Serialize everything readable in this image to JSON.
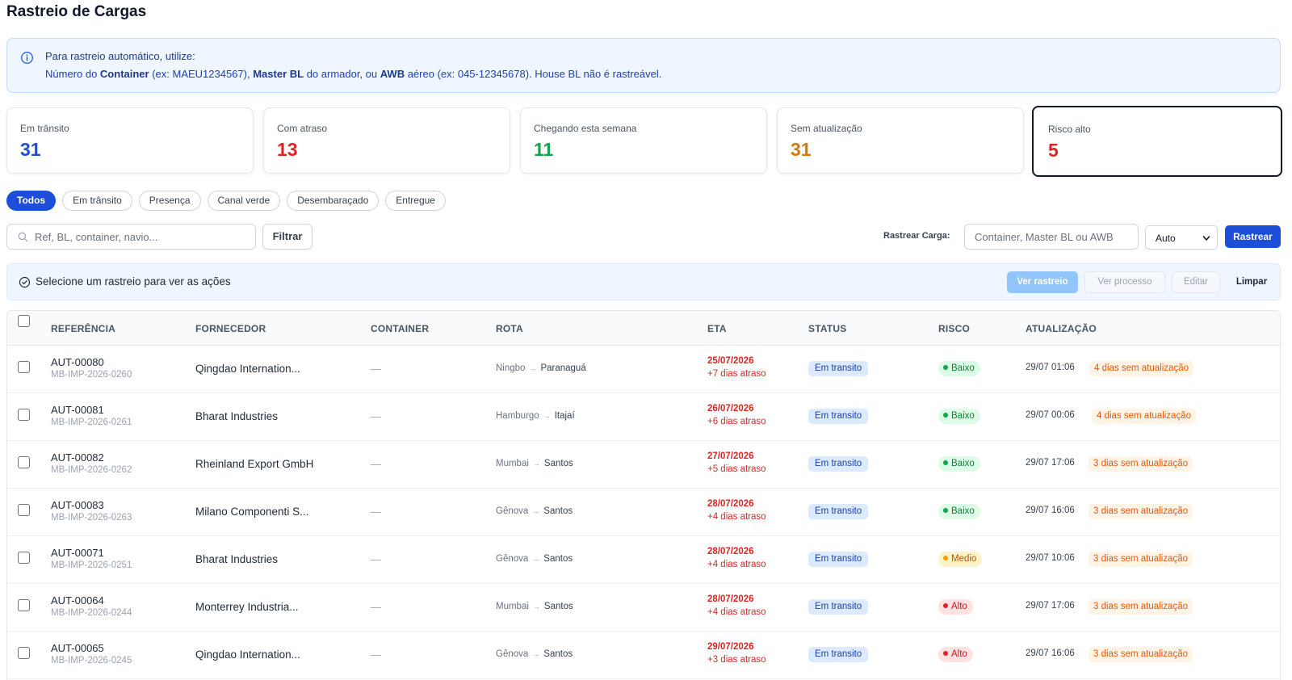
{
  "page": {
    "title": "Rastreio de Cargas"
  },
  "info": {
    "line1": "Para rastreio automático, utilize:",
    "l2_a": "Número do ",
    "l2_b": "Container",
    "l2_c": " (ex: MAEU1234567), ",
    "l2_d": "Master BL",
    "l2_e": " do armador, ou ",
    "l2_f": "AWB",
    "l2_g": " aéreo (ex: 045-12345678). House BL não é rastreável."
  },
  "stats": [
    {
      "label": "Em trânsito",
      "value": "31",
      "color": "#1d4ed8"
    },
    {
      "label": "Com atraso",
      "value": "13",
      "color": "#dc2626"
    },
    {
      "label": "Chegando esta semana",
      "value": "11",
      "color": "#16a34a"
    },
    {
      "label": "Sem atualização",
      "value": "31",
      "color": "#d97706"
    },
    {
      "label": "Risco alto",
      "value": "5",
      "color": "#dc2626"
    }
  ],
  "filters": [
    "Todos",
    "Em trânsito",
    "Presença",
    "Canal verde",
    "Desembaraçado",
    "Entregue"
  ],
  "search": {
    "placeholder": "Ref, BL, container, navio...",
    "filter_label": "Filtrar"
  },
  "track": {
    "label": "Rastrear Carga:",
    "placeholder": "Container, Master BL ou AWB",
    "mode": "Auto",
    "button": "Rastrear"
  },
  "action_bar": {
    "text": "Selecione um rastreio para ver as ações",
    "view": "Ver rastreio",
    "process": "Ver processo",
    "edit": "Editar",
    "clear": "Limpar"
  },
  "table": {
    "columns": [
      "REFERÊNCIA",
      "FORNECEDOR",
      "CONTAINER",
      "ROTA",
      "ETA",
      "STATUS",
      "RISCO",
      "ATUALIZAÇÃO"
    ],
    "rows": [
      {
        "ref": "AUT-00080",
        "bl": "MB-IMP-2026-0260",
        "supplier": "Qingdao Internation...",
        "container": "—",
        "origin": "Ningbo",
        "dest": "Paranaguá",
        "eta": "25/07/2026",
        "delay": "+7 dias atraso",
        "status": "Em transito",
        "risk": "Baixo",
        "risk_level": "low",
        "updated": "29/07 01:06",
        "stale": "4 dias sem atualização"
      },
      {
        "ref": "AUT-00081",
        "bl": "MB-IMP-2026-0261",
        "supplier": "Bharat Industries",
        "container": "—",
        "origin": "Hamburgo",
        "dest": "Itajaí",
        "eta": "26/07/2026",
        "delay": "+6 dias atraso",
        "status": "Em transito",
        "risk": "Baixo",
        "risk_level": "low",
        "updated": "29/07 00:06",
        "stale": "4 dias sem atualização"
      },
      {
        "ref": "AUT-00082",
        "bl": "MB-IMP-2026-0262",
        "supplier": "Rheinland Export GmbH",
        "container": "—",
        "origin": "Mumbai",
        "dest": "Santos",
        "eta": "27/07/2026",
        "delay": "+5 dias atraso",
        "status": "Em transito",
        "risk": "Baixo",
        "risk_level": "low",
        "updated": "29/07 17:06",
        "stale": "3 dias sem atualização"
      },
      {
        "ref": "AUT-00083",
        "bl": "MB-IMP-2026-0263",
        "supplier": "Milano Componenti S...",
        "container": "—",
        "origin": "Gênova",
        "dest": "Santos",
        "eta": "28/07/2026",
        "delay": "+4 dias atraso",
        "status": "Em transito",
        "risk": "Baixo",
        "risk_level": "low",
        "updated": "29/07 16:06",
        "stale": "3 dias sem atualização"
      },
      {
        "ref": "AUT-00071",
        "bl": "MB-IMP-2026-0251",
        "supplier": "Bharat Industries",
        "container": "—",
        "origin": "Gênova",
        "dest": "Santos",
        "eta": "28/07/2026",
        "delay": "+4 dias atraso",
        "status": "Em transito",
        "risk": "Medio",
        "risk_level": "med",
        "updated": "29/07 10:06",
        "stale": "3 dias sem atualização"
      },
      {
        "ref": "AUT-00064",
        "bl": "MB-IMP-2026-0244",
        "supplier": "Monterrey Industria...",
        "container": "—",
        "origin": "Mumbai",
        "dest": "Santos",
        "eta": "28/07/2026",
        "delay": "+4 dias atraso",
        "status": "Em transito",
        "risk": "Alto",
        "risk_level": "high",
        "updated": "29/07 17:06",
        "stale": "3 dias sem atualização"
      },
      {
        "ref": "AUT-00065",
        "bl": "MB-IMP-2026-0245",
        "supplier": "Qingdao Internation...",
        "container": "—",
        "origin": "Gênova",
        "dest": "Santos",
        "eta": "29/07/2026",
        "delay": "+3 dias atraso",
        "status": "Em transito",
        "risk": "Alto",
        "risk_level": "high",
        "updated": "29/07 16:06",
        "stale": "3 dias sem atualização"
      }
    ]
  }
}
